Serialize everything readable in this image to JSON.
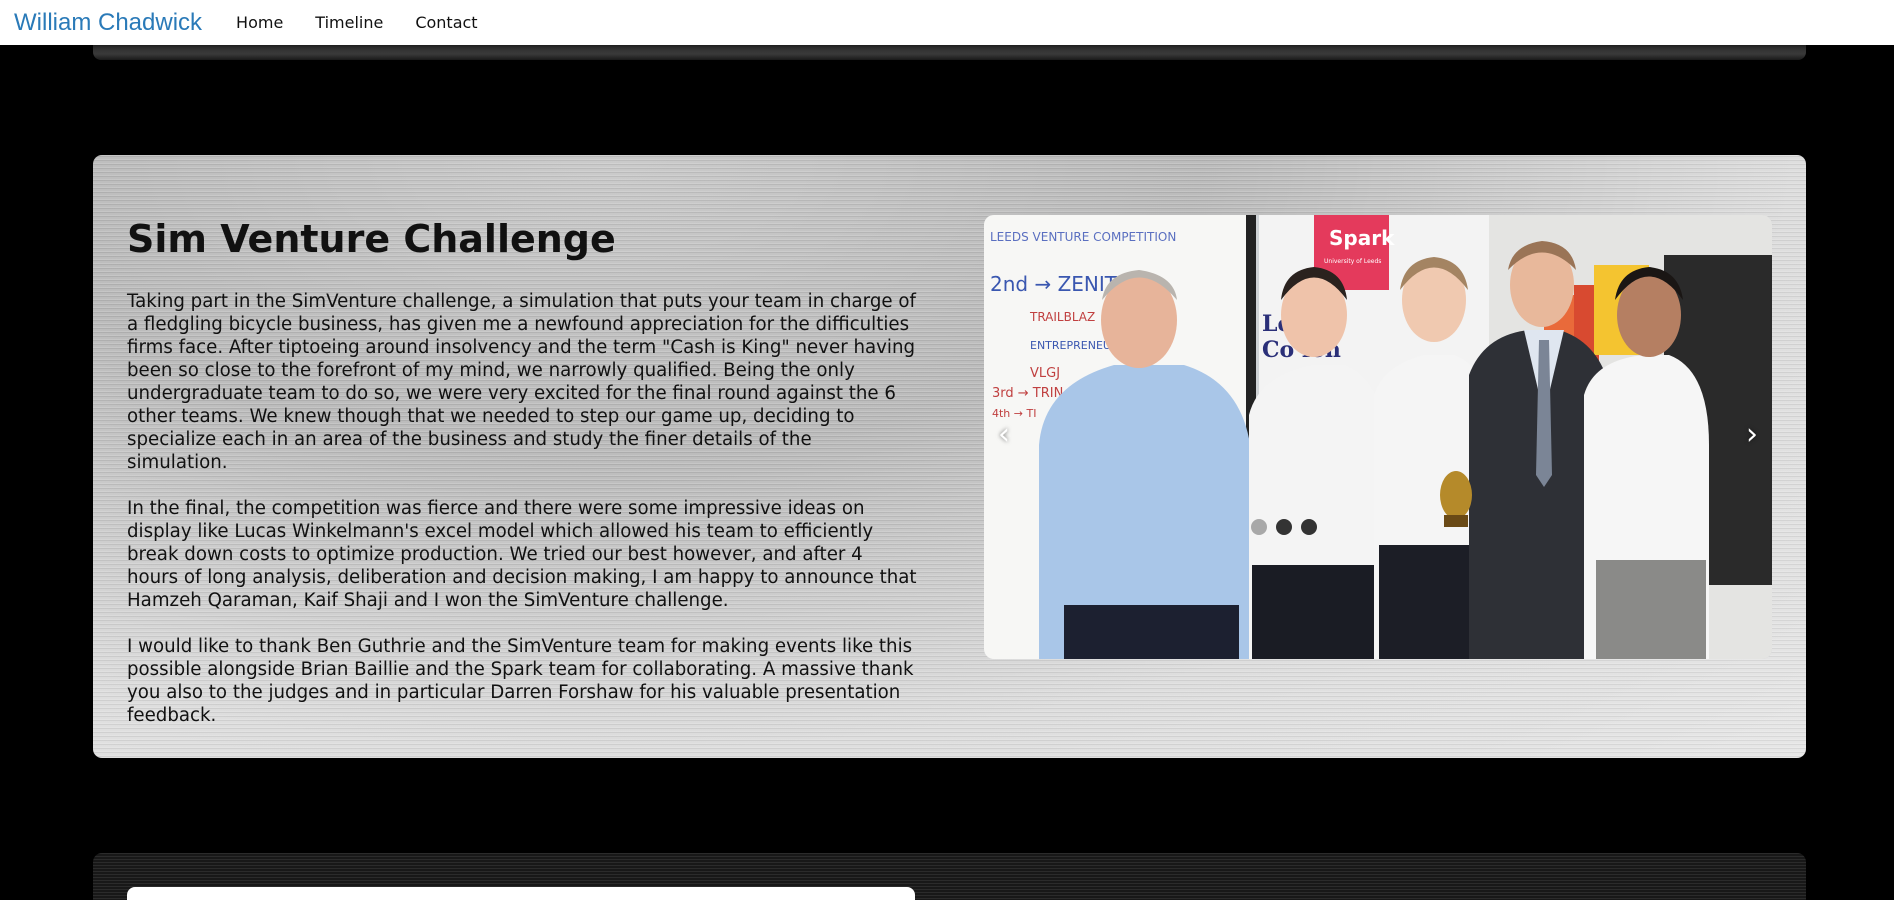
{
  "nav": {
    "brand": "William Chadwick",
    "links": [
      "Home",
      "Timeline",
      "Contact"
    ]
  },
  "section": {
    "title": "Sim Venture Challenge",
    "paragraphs": [
      "Taking part in the SimVenture challenge, a simulation that puts your team in charge of a fledgling bicycle business, has given me a newfound appreciation for the difficulties firms face. After tiptoeing around insolvency and the term \"Cash is King\" never having been so close to the forefront of my mind, we narrowly qualified. Being the only undergraduate team to do so, we were very excited for the final round against the 6 other teams. We knew though that we needed to step our game up, deciding to specialize each in an area of the business and study the finer details of the simulation.",
      "In the final, the competition was fierce and there were some impressive ideas on display like Lucas Winkelmann's excel model which allowed his team to efficiently break down costs to optimize production. We tried our best however, and after 4 hours of long analysis, deliberation and decision making, I am happy to announce that Hamzeh Qaraman, Kaif Shaji and I won the SimVenture challenge.",
      "I would like to thank Ben Guthrie and the SimVenture team for making events like this possible alongside Brian Baillie and the Spark team for collaborating. A massive thank you also to the judges and in particular Darren Forshaw for his valuable presentation feedback."
    ]
  },
  "carousel": {
    "prev": "‹",
    "next": "›",
    "slide_count": 3,
    "active_index": 0,
    "photo_text": {
      "whiteboard_heading": "LEEDS VENTURE COMPETITION",
      "whiteboard_line1": "2nd → ZENITH",
      "whiteboard_line2": "TRAILBLAZ",
      "whiteboard_line3": "ENTREPRENEUR",
      "whiteboard_line4": "VLGJ",
      "whiteboard_line5": "3rd → TRIN",
      "whiteboard_line6": "4th → TI",
      "banner_logo": "Spark",
      "banner_sub": "University of Leeds",
      "banner_line1": "Le    ure",
      "banner_line2": "Co    ion"
    }
  },
  "colors": {
    "brand": "#2a7ab8",
    "dot_active": "#a8a8a8",
    "dot_inactive": "#333333"
  }
}
